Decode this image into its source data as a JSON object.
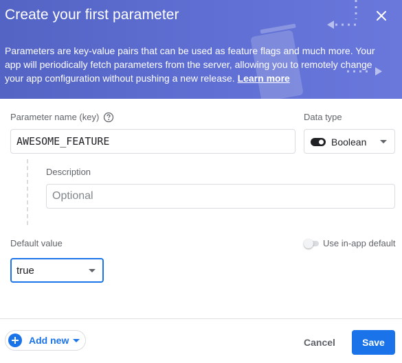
{
  "dialog": {
    "title": "Create your first parameter",
    "intro_text": "Parameters are key-value pairs that can be used as feature flags and much more. Your app will periodically fetch parameters from the server, allowing you to remotely change your app configuration without pushing a new release.",
    "learn_more_label": "Learn more",
    "close_icon": "close-icon"
  },
  "form": {
    "param_name_label": "Parameter name (key)",
    "param_name_value": "AWESOME_FEATURE",
    "help_icon": "help-circle-icon",
    "data_type_label": "Data type",
    "data_type_value": "Boolean",
    "description_label": "Description",
    "description_placeholder": "Optional",
    "default_value_label": "Default value",
    "use_inapp_default_label": "Use in-app default",
    "use_inapp_default_enabled": false,
    "default_value": "true"
  },
  "footer": {
    "add_new_label": "Add new",
    "cancel_label": "Cancel",
    "save_label": "Save"
  },
  "colors": {
    "header_bg": "#5b6bcf",
    "accent": "#1a73e8",
    "muted_text": "#5f6368"
  }
}
